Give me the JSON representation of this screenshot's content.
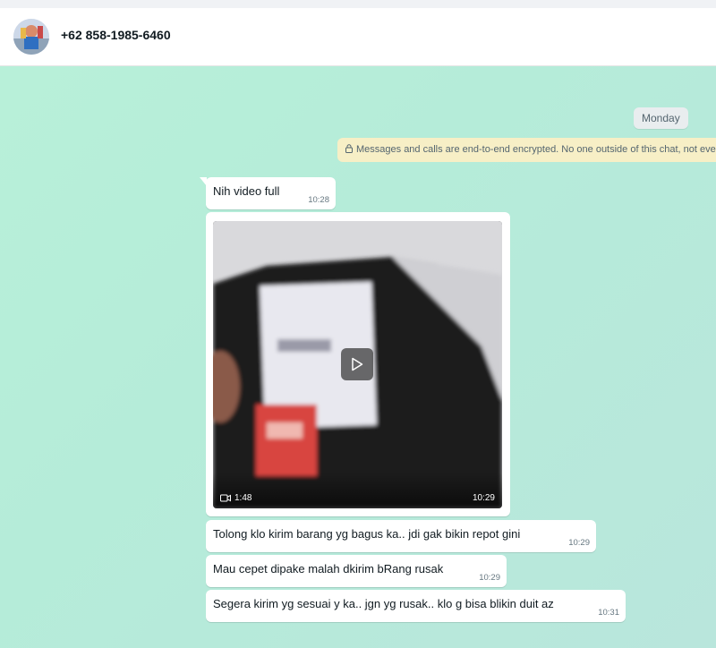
{
  "contact": {
    "name": "+62 858-1985-6460",
    "avatar_icon": "contact-avatar"
  },
  "chat": {
    "day_label": "Monday",
    "encryption_notice": "Messages and calls are end-to-end encrypted. No one outside of this chat, not even WhatsApp, can read or listen to them.",
    "messages": [
      {
        "text": "Nih video full",
        "time": "10:28"
      },
      {
        "type": "video",
        "duration": "1:48",
        "time": "10:29"
      },
      {
        "text": "Tolong klo kirim barang yg bagus ka.. jdi gak bikin repot gini",
        "time": "10:29"
      },
      {
        "text": "Mau cepet dipake malah dkirim bRang rusak",
        "time": "10:29"
      },
      {
        "text": "Segera kirim yg sesuai y ka.. jgn yg rusak.. klo  g bisa blikin duit az",
        "time": "10:31"
      }
    ]
  },
  "colors": {
    "chat_bg": "#b8f0d9",
    "bubble": "#ffffff",
    "banner": "#f7efc6"
  }
}
